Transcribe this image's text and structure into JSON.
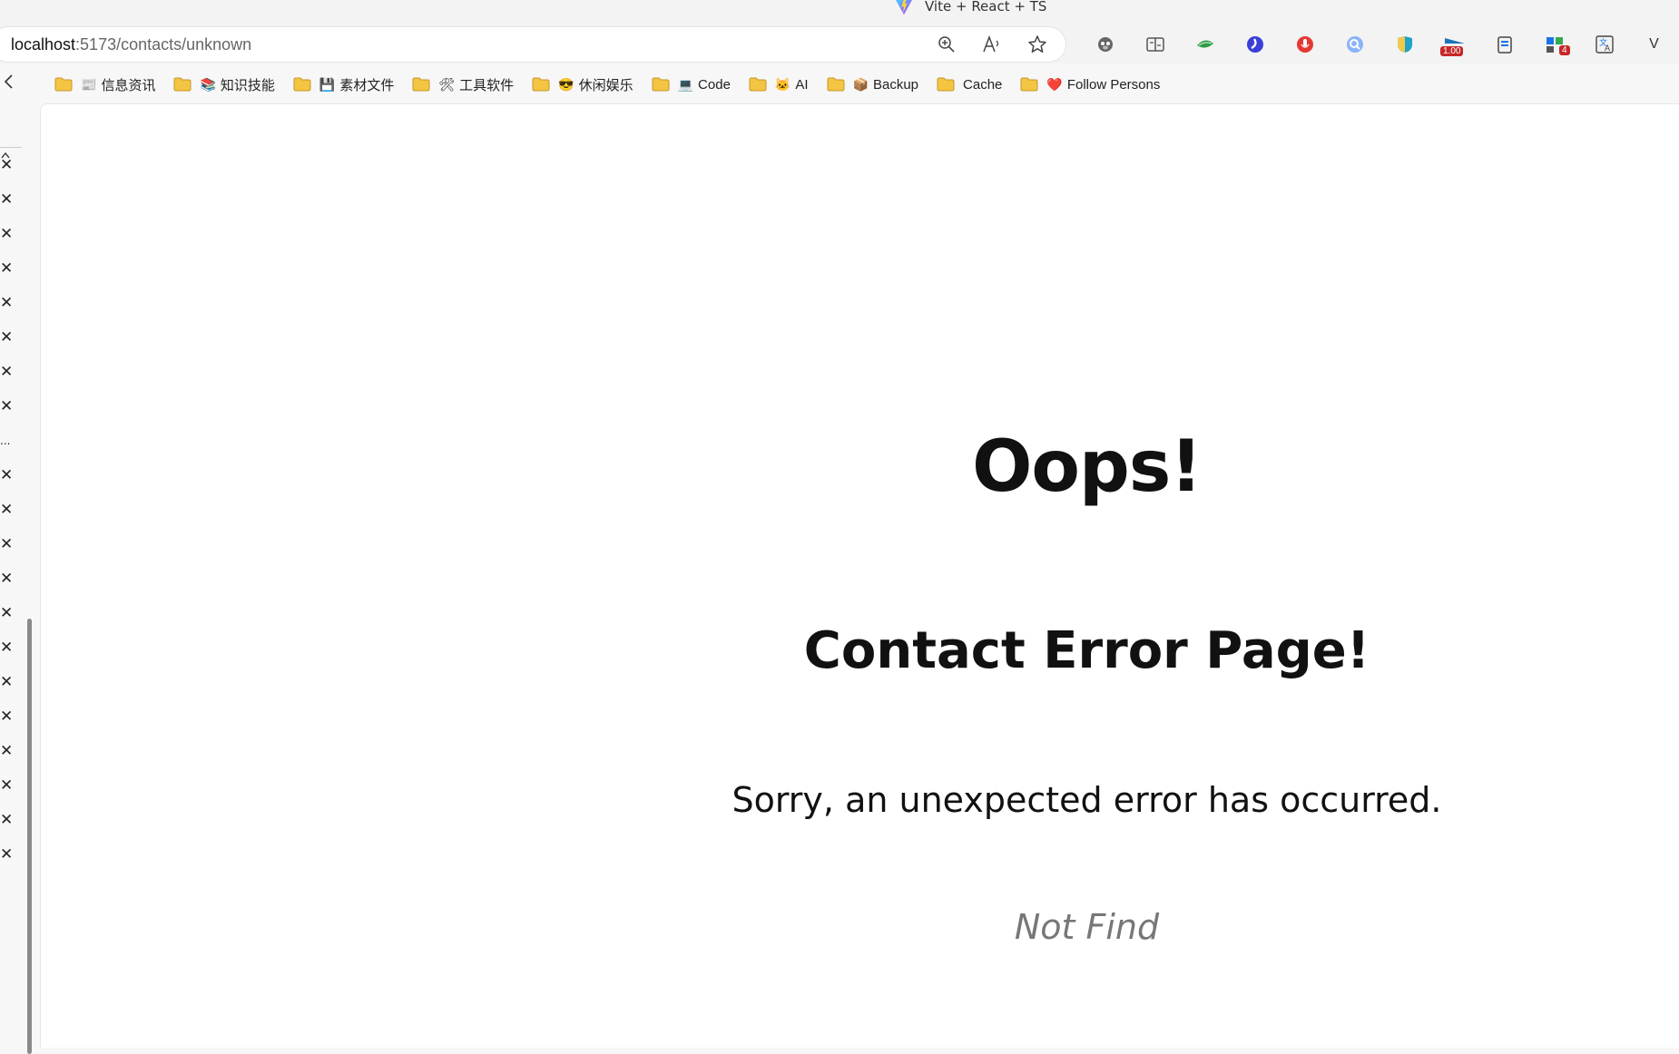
{
  "window": {
    "title": "Vite + React + TS"
  },
  "address_bar": {
    "url_host": "localhost",
    "url_rest": ":5173/contacts/unknown",
    "icons": [
      "zoom-icon",
      "read-aloud-icon",
      "favorite-star-icon"
    ]
  },
  "extensions": [
    {
      "name": "ext-monkey-icon"
    },
    {
      "name": "ext-reader-icon"
    },
    {
      "name": "ext-green-leaf-icon"
    },
    {
      "name": "ext-blue-swirl-icon"
    },
    {
      "name": "ext-red-mic-icon"
    },
    {
      "name": "ext-search-circle-icon"
    },
    {
      "name": "ext-shield-icon"
    },
    {
      "name": "ext-speed-icon",
      "badge": "1.00"
    },
    {
      "name": "ext-clipboard-icon"
    },
    {
      "name": "ext-puzzle-icon",
      "badge": "4"
    },
    {
      "name": "ext-translate-icon"
    },
    {
      "name": "ext-v-icon",
      "label": "V"
    }
  ],
  "bookmarks": [
    {
      "emoji": "📰",
      "label": "信息资讯"
    },
    {
      "emoji": "📚",
      "label": "知识技能"
    },
    {
      "emoji": "💾",
      "label": "素材文件"
    },
    {
      "emoji": "🛠",
      "label": "工具软件"
    },
    {
      "emoji": "😎",
      "label": "休闲娱乐"
    },
    {
      "emoji": "💻",
      "label": "Code"
    },
    {
      "emoji": "🐱",
      "label": "AI"
    },
    {
      "emoji": "📦",
      "label": "Backup"
    },
    {
      "emoji": "",
      "label": "Cache"
    },
    {
      "emoji": "❤️",
      "label": "Follow Persons"
    }
  ],
  "side_tabs": {
    "ellipsis": "...",
    "close_glyph": "✕"
  },
  "error_page": {
    "heading": "Oops!",
    "subheading": "Contact Error Page!",
    "message": "Sorry, an unexpected error has occurred.",
    "detail": "Not Find"
  },
  "colors": {
    "folder": "#f4c542",
    "detail_text": "#777777",
    "heading_text": "#111111"
  }
}
